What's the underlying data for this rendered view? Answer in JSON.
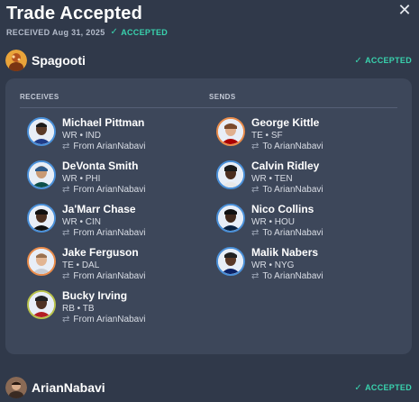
{
  "header": {
    "title": "Trade Accepted",
    "received_label": "RECEIVED Aug 31, 2025",
    "status_label": "ACCEPTED",
    "close_label": "✕"
  },
  "parties": [
    {
      "name": "Spagooti",
      "status": "ACCEPTED"
    },
    {
      "name": "ArianNabavi",
      "status": "ACCEPTED"
    }
  ],
  "trade": {
    "receives_label": "RECEIVES",
    "sends_label": "SENDS",
    "receives": [
      {
        "name": "Michael Pittman",
        "pos": "WR • IND",
        "note": "From ArianNabavi"
      },
      {
        "name": "DeVonta Smith",
        "pos": "WR • PHI",
        "note": "From ArianNabavi"
      },
      {
        "name": "Ja'Marr Chase",
        "pos": "WR • CIN",
        "note": "From ArianNabavi"
      },
      {
        "name": "Jake Ferguson",
        "pos": "TE • DAL",
        "note": "From ArianNabavi"
      },
      {
        "name": "Bucky Irving",
        "pos": "RB • TB",
        "note": "From ArianNabavi"
      }
    ],
    "sends": [
      {
        "name": "George Kittle",
        "pos": "TE • SF",
        "note": "To ArianNabavi"
      },
      {
        "name": "Calvin Ridley",
        "pos": "WR • TEN",
        "note": "To ArianNabavi"
      },
      {
        "name": "Nico Collins",
        "pos": "WR • HOU",
        "note": "To ArianNabavi"
      },
      {
        "name": "Malik Nabers",
        "pos": "WR • NYG",
        "note": "To ArianNabavi"
      }
    ]
  },
  "icons": {
    "check": "check-icon",
    "swap": "swap-arrows-icon",
    "close": "close-icon"
  },
  "colors": {
    "background": "#30394a",
    "panel": "#3d475a",
    "accent": "#39d3ae"
  }
}
